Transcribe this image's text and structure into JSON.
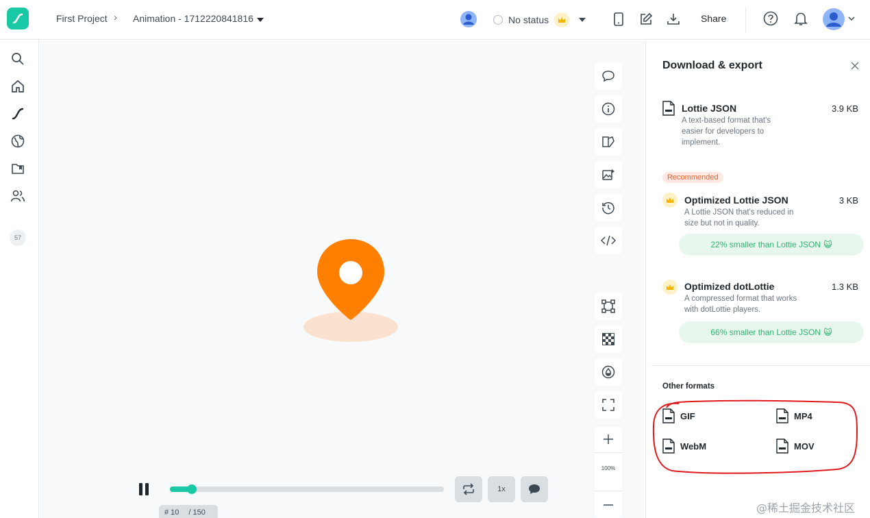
{
  "header": {
    "breadcrumb_project": "First Project",
    "breadcrumb_animation": "Animation - 1712220841816",
    "status_label": "No status",
    "share_label": "Share",
    "icons": [
      "logo-icon",
      "chevron-right-icon",
      "caret-down-icon",
      "avatar-icon",
      "crown-icon",
      "mobile-icon",
      "edit-icon",
      "download-icon",
      "help-icon",
      "bell-icon",
      "user-avatar-icon"
    ]
  },
  "sidebar": {
    "icons": [
      "search-icon",
      "home-icon",
      "lottie-icon",
      "globe-icon",
      "folder-icon",
      "users-icon"
    ],
    "badge": "57"
  },
  "toolbar": {
    "icons": [
      "comment-icon",
      "info-icon",
      "layers-icon",
      "image-icon",
      "history-icon",
      "code-icon",
      "frame-icon",
      "checker-icon",
      "drop-icon",
      "fullscreen-icon",
      "zoom-in-icon",
      "zoom-out-icon"
    ],
    "zoom_level": "100%"
  },
  "player": {
    "progress": 0.067,
    "frame_prefix": "# 10",
    "frame_total": "/ 150",
    "speed_label": "1x"
  },
  "panel": {
    "title": "Download & export",
    "lottie": {
      "name": "Lottie JSON",
      "size": "3.9 KB",
      "desc": "A text-based format that's easier for developers to implement."
    },
    "recommended": "Recommended",
    "optimized_lottie": {
      "name": "Optimized Lottie JSON",
      "size": "3 KB",
      "desc": "A Lottie JSON that's reduced in size but not in quality.",
      "saving": "22% smaller than Lottie JSON"
    },
    "optimized_dotlottie": {
      "name": "Optimized dotLottie",
      "size": "1.3 KB",
      "desc": "A compressed format that works with dotLottie players.",
      "saving": "66% smaller than Lottie JSON"
    },
    "other_title": "Other formats",
    "other": {
      "gif": "GIF",
      "mp4": "MP4",
      "webm": "WebM",
      "mov": "MOV"
    }
  },
  "colors": {
    "accent": "#19c8a4",
    "pin": "#ff8000",
    "annotation": "#e0191d"
  },
  "watermark": "@稀土掘金技术社区"
}
